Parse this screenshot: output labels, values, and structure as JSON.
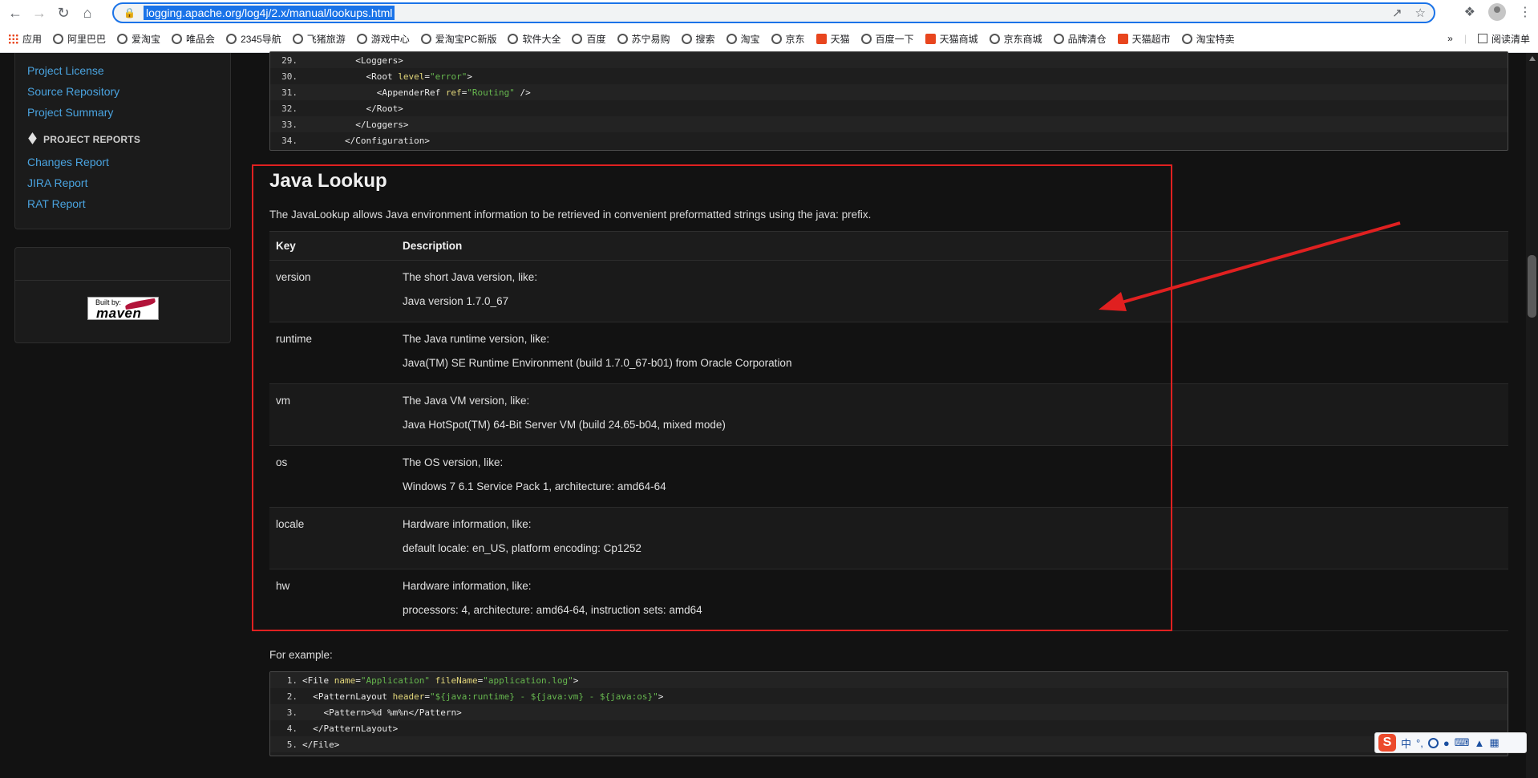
{
  "browser": {
    "url": "logging.apache.org/log4j/2.x/manual/lookups.html",
    "bookmarks": [
      {
        "label": "应用",
        "icon": "apps-grid-icon"
      },
      {
        "label": "阿里巴巴",
        "icon": "globe-icon"
      },
      {
        "label": "爱淘宝",
        "icon": "globe-icon"
      },
      {
        "label": "唯品会",
        "icon": "globe-icon"
      },
      {
        "label": "2345导航",
        "icon": "globe-icon"
      },
      {
        "label": "飞猪旅游",
        "icon": "globe-icon"
      },
      {
        "label": "游戏中心",
        "icon": "globe-icon"
      },
      {
        "label": "爱淘宝PC新版",
        "icon": "globe-icon"
      },
      {
        "label": "软件大全",
        "icon": "globe-icon"
      },
      {
        "label": "百度",
        "icon": "globe-icon"
      },
      {
        "label": "苏宁易购",
        "icon": "globe-icon"
      },
      {
        "label": "搜索",
        "icon": "globe-icon"
      },
      {
        "label": "淘宝",
        "icon": "globe-icon"
      },
      {
        "label": "京东",
        "icon": "globe-icon"
      },
      {
        "label": "天猫",
        "icon": "tmall-icon"
      },
      {
        "label": "百度一下",
        "icon": "globe-icon"
      },
      {
        "label": "天猫商城",
        "icon": "tmall-icon"
      },
      {
        "label": "京东商城",
        "icon": "globe-icon"
      },
      {
        "label": "品牌清仓",
        "icon": "globe-icon"
      },
      {
        "label": "天猫超市",
        "icon": "tmall-icon"
      },
      {
        "label": "淘宝特卖",
        "icon": "globe-icon"
      }
    ],
    "more": "»",
    "reading_list": "阅读清单"
  },
  "sidebar": {
    "links_top": [
      "Project License",
      "Source Repository",
      "Project Summary"
    ],
    "reports_heading": "PROJECT REPORTS",
    "links_reports": [
      "Changes Report",
      "JIRA Report",
      "RAT Report"
    ],
    "built_by": {
      "small": "Built by:",
      "big": "maven"
    }
  },
  "code_top": {
    "lines": [
      {
        "n": "29.",
        "indent": "          ",
        "parts": [
          [
            "tag",
            "<Loggers>"
          ]
        ]
      },
      {
        "n": "30.",
        "indent": "            ",
        "parts": [
          [
            "tag",
            "<Root "
          ],
          [
            "attr",
            "level"
          ],
          [
            "tag",
            "="
          ],
          [
            "str",
            "\"error\""
          ],
          [
            "tag",
            ">"
          ]
        ]
      },
      {
        "n": "31.",
        "indent": "              ",
        "parts": [
          [
            "tag",
            "<AppenderRef "
          ],
          [
            "attr",
            "ref"
          ],
          [
            "tag",
            "="
          ],
          [
            "str",
            "\"Routing\""
          ],
          [
            "tag",
            " />"
          ]
        ]
      },
      {
        "n": "32.",
        "indent": "            ",
        "parts": [
          [
            "tag",
            "</Root>"
          ]
        ]
      },
      {
        "n": "33.",
        "indent": "          ",
        "parts": [
          [
            "tag",
            "</Loggers>"
          ]
        ]
      },
      {
        "n": "34.",
        "indent": "        ",
        "parts": [
          [
            "tag",
            "</Configuration>"
          ]
        ]
      }
    ]
  },
  "section": {
    "title": "Java Lookup",
    "intro": "The JavaLookup allows Java environment information to be retrieved in convenient preformatted strings using the java: prefix.",
    "headers": {
      "key": "Key",
      "description": "Description"
    },
    "rows": [
      {
        "key": "version",
        "line1": "The short Java version, like:",
        "line2": "Java version 1.7.0_67"
      },
      {
        "key": "runtime",
        "line1": "The Java runtime version, like:",
        "line2": "Java(TM) SE Runtime Environment (build 1.7.0_67-b01) from Oracle Corporation"
      },
      {
        "key": "vm",
        "line1": "The Java VM version, like:",
        "line2": "Java HotSpot(TM) 64-Bit Server VM (build 24.65-b04, mixed mode)"
      },
      {
        "key": "os",
        "line1": "The OS version, like:",
        "line2": "Windows 7 6.1 Service Pack 1, architecture: amd64-64"
      },
      {
        "key": "locale",
        "line1": "Hardware information, like:",
        "line2": "default locale: en_US, platform encoding: Cp1252"
      },
      {
        "key": "hw",
        "line1": "Hardware information, like:",
        "line2": "processors: 4, architecture: amd64-64, instruction sets: amd64"
      }
    ],
    "example_label": "For example:"
  },
  "code_bottom": {
    "lines": [
      {
        "n": "1.",
        "indent": "",
        "parts": [
          [
            "tag",
            "<File "
          ],
          [
            "attr",
            "name"
          ],
          [
            "tag",
            "="
          ],
          [
            "str",
            "\"Application\""
          ],
          [
            "tag",
            " "
          ],
          [
            "attr",
            "fileName"
          ],
          [
            "tag",
            "="
          ],
          [
            "str",
            "\"application.log\""
          ],
          [
            "tag",
            ">"
          ]
        ]
      },
      {
        "n": "2.",
        "indent": "  ",
        "parts": [
          [
            "tag",
            "<PatternLayout "
          ],
          [
            "attr",
            "header"
          ],
          [
            "tag",
            "="
          ],
          [
            "str",
            "\"${java:runtime} - ${java:vm} - ${java:os}\""
          ],
          [
            "tag",
            ">"
          ]
        ]
      },
      {
        "n": "3.",
        "indent": "    ",
        "parts": [
          [
            "tag",
            "<Pattern>%d %m%n</Pattern>"
          ]
        ]
      },
      {
        "n": "4.",
        "indent": "  ",
        "parts": [
          [
            "tag",
            "</PatternLayout>"
          ]
        ]
      },
      {
        "n": "5.",
        "indent": "",
        "parts": [
          [
            "tag",
            "</File>"
          ]
        ]
      }
    ]
  },
  "ime": {
    "logo": "S",
    "lang": "中",
    "punct": "°,"
  },
  "colors": {
    "highlight": "#e02020",
    "link": "#4aa3df",
    "accent": "#1a73e8"
  }
}
